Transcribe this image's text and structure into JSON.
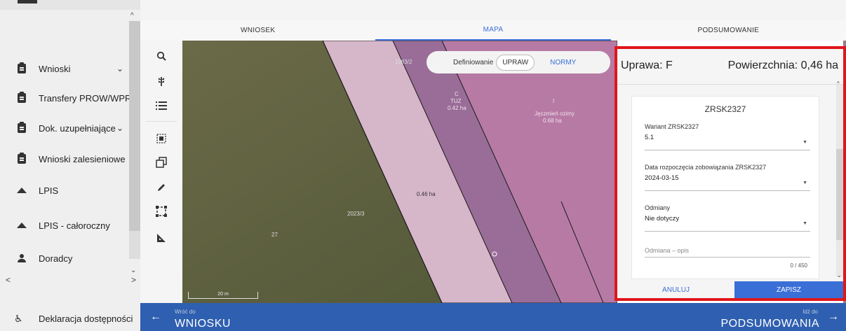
{
  "sidebar": {
    "items": [
      {
        "label": "Wnioski",
        "icon": "clipboard-icon",
        "chevron": "⌄"
      },
      {
        "label": "Transfery PROW/WPR",
        "icon": "clipboard-icon",
        "chevron": ""
      },
      {
        "label": "Dok. uzupełniające",
        "icon": "clipboard-icon",
        "chevron": "⌄"
      },
      {
        "label": "Wnioski zalesieniowe",
        "icon": "clipboard-icon",
        "chevron": ""
      },
      {
        "label": "LPIS",
        "icon": "terrain-icon",
        "chevron": ""
      },
      {
        "label": "LPIS - całoroczny",
        "icon": "terrain-icon",
        "chevron": ""
      },
      {
        "label": "Doradcy",
        "icon": "person-icon",
        "chevron": ""
      }
    ],
    "accessibility_label": "Deklaracja dostępności"
  },
  "tabs": [
    {
      "label": "WNIOSEK",
      "active": false
    },
    {
      "label": "MAPA",
      "active": true
    },
    {
      "label": "PODSUMOWANIE",
      "active": false
    }
  ],
  "map": {
    "toggle_label": "Definiowanie",
    "toggle_selected": "UPRAW",
    "toggle_other": "NORMY",
    "labels": {
      "parcel_c": "C",
      "parcel_c_crop": "TUZ",
      "parcel_c_area": "0.42 ha",
      "parcel_i": "I",
      "parcel_i_crop": "Jęczmień ozimy",
      "parcel_i_area": "0.68 ha",
      "parcel_f_area": "0.46 ha",
      "parcel_number": "27",
      "parcel_id_top": "1083/2",
      "parcel_id_mid": "2023/3",
      "scale": "20 m"
    }
  },
  "panel": {
    "crop_label": "Uprawa: F",
    "area_label": "Powierzchnia: 0,46 ha",
    "card_title": "ZRSK2327",
    "fields": [
      {
        "label": "Wariant ZRSK2327",
        "value": "5.1"
      },
      {
        "label": "Data rozpoczęcia zobowiązania ZRSK2327",
        "value": "2024-03-15"
      },
      {
        "label": "Odmiany",
        "value": "Nie dotyczy"
      }
    ],
    "textarea_placeholder": "Odmiana – opis",
    "counter": "0 / 450",
    "cancel_label": "ANULUJ",
    "save_label": "ZAPISZ"
  },
  "bottombar": {
    "prev_small": "Wróć do",
    "prev_big": "WNIOSKU",
    "next_small": "Idź do",
    "next_big": "PODSUMOWANIA"
  },
  "colors": {
    "accent": "#3a6fd8",
    "bottombar": "#2f5fb0",
    "highlight_frame": "#e0161b"
  }
}
